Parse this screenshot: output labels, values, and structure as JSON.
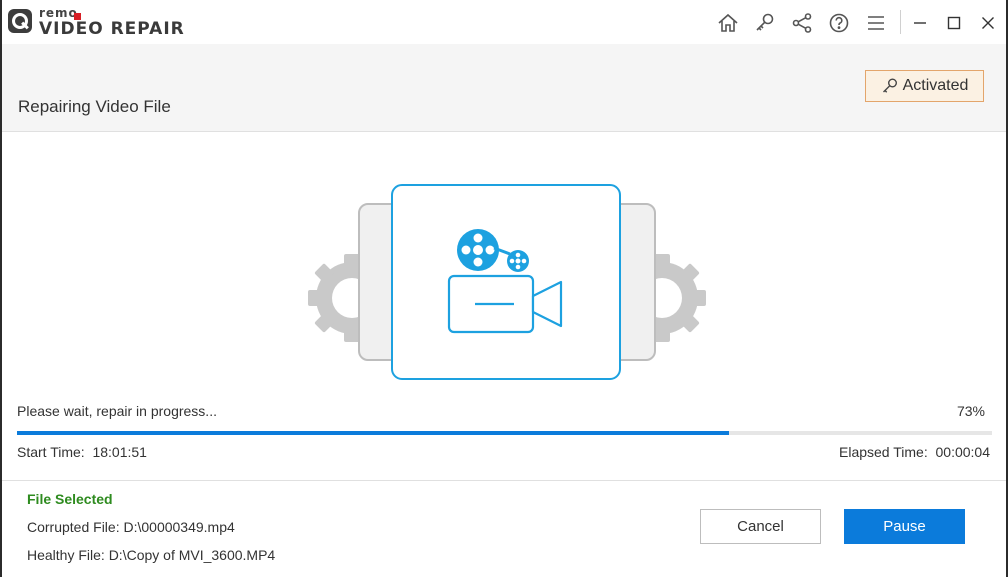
{
  "app": {
    "logo_small": "remo",
    "logo_name": "VIDEO REPAIR"
  },
  "toolbar": {
    "icons": [
      "home-icon",
      "key-icon",
      "share-icon",
      "help-icon",
      "menu-icon",
      "minimize-icon",
      "maximize-icon",
      "close-icon"
    ]
  },
  "header": {
    "title": "Repairing Video File",
    "activated_label": "Activated"
  },
  "progress": {
    "status": "Please wait, repair in progress...",
    "percent_label": "73%",
    "percent_value": 0.73,
    "start_time_label": "Start Time:",
    "start_time": "18:01:51",
    "elapsed_time_label": "Elapsed Time:",
    "elapsed_time": "00:00:04"
  },
  "footer": {
    "file_selected_label": "File Selected",
    "corrupted_file": "Corrupted File: D:\\00000349.mp4",
    "healthy_file": "Healthy File: D:\\Copy of MVI_3600.MP4",
    "cancel_label": "Cancel",
    "pause_label": "Pause"
  },
  "colors": {
    "accent": "#0b7bdb",
    "illustration_blue": "#1da1e0",
    "gear_gray": "#bdbdbd",
    "file_selected_green": "#2e8b1f",
    "activated_border": "#e3a56b"
  }
}
